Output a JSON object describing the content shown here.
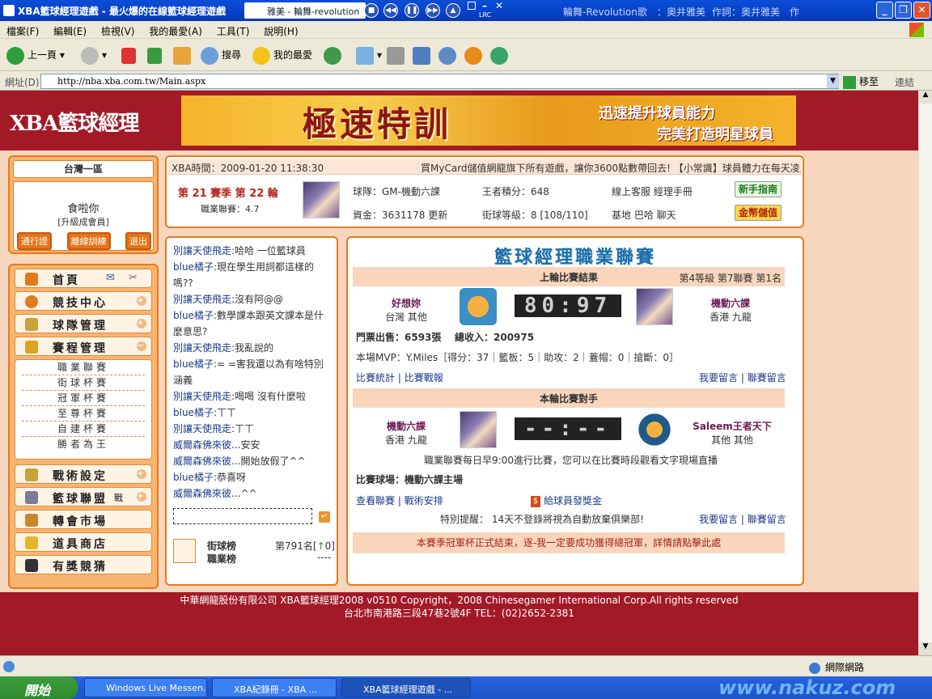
{
  "window": {
    "title": "XBA籃球經理遊戲 - 最火爆的在線籃球經理遊戲",
    "player_track": "雅美 - 輪舞-revolution",
    "lrc_label": "LRC",
    "song_title": "輪舞-Revolution",
    "song_info_song": "歌",
    "song_info_singer": "：奧井雅美",
    "song_info_lyricist": "作詞：奧井雅美",
    "song_info_more": "作"
  },
  "menu": [
    "檔案(F)",
    "編輯(E)",
    "檢視(V)",
    "我的最愛(A)",
    "工具(T)",
    "說明(H)"
  ],
  "toolbar": {
    "back": "上一頁",
    "search": "搜尋",
    "favorites": "我的最愛"
  },
  "address": {
    "label": "網址(D)",
    "url": "http://nba.xba.com.tw/Main.aspx",
    "go": "移至",
    "links": "連結"
  },
  "header": {
    "logo": "XBA籃球經理",
    "banner_title": "極速特訓",
    "banner_line1": "迅速提升球員能力",
    "banner_line2": "完美打造明星球員"
  },
  "user": {
    "region": "台灣一區",
    "name": "食啦你",
    "level": "[升級成會員]",
    "buttons": [
      "通行證",
      "離線訓練",
      "退出"
    ]
  },
  "nav": {
    "items": [
      "首頁",
      "競技中心",
      "球隊管理",
      "賽程管理",
      "戰術設定",
      "籃球聯盟",
      "轉會市場",
      "道具商店",
      "有獎競猜"
    ],
    "alliance_suffix": "戰",
    "sub": [
      "職業聯賽",
      "街球杯賽",
      "冠軍杯賽",
      "至尊杯賽",
      "自建杯賽",
      "勝者為王"
    ]
  },
  "info": {
    "time": "XBA時間：2009-01-20 11:38:30",
    "marquee": "買MyCard儲值網龍旗下所有遊戲，讓你3600點數帶回去! 【小常識】球員體力在每天凌晨",
    "season": "第 21 賽季  第 22 輪",
    "career_score": "職業聯賽：4.7",
    "team": "球隊：GM-機動六課",
    "points": "王者積分：648",
    "service": "線上客服  經理手冊",
    "newbie_btn": "新手指南",
    "funds": "資金：3631178  更新",
    "street_level": "街球等級：8 [108/110]",
    "base": "基地  巴哈  聊天",
    "gold_btn": "金幣儲值"
  },
  "chat": [
    {
      "name": "別讓天使飛走",
      "msg": ":哈哈  一位籃球員"
    },
    {
      "name": "blue橘子",
      "msg": ":現在學生用詞都這樣的嗎??"
    },
    {
      "name": "別讓天使飛走",
      "msg": ":沒有阿@@"
    },
    {
      "name": "blue橘子",
      "msg": ":數學課本跟英文課本是什麼意思?"
    },
    {
      "name": "別讓天使飛走",
      "msg": ":我亂說的"
    },
    {
      "name": "blue橘子",
      "msg": ":= =害我還以為有啥特別涵義"
    },
    {
      "name": "別讓天使飛走",
      "msg": ":喝喝  沒有什麼啦"
    },
    {
      "name": "blue橘子",
      "msg": ":ㄒㄒ"
    },
    {
      "name": "別讓天使飛走",
      "msg": ":ㄒㄒ"
    },
    {
      "name": "威爾森佛來彼",
      "msg": "...安安"
    },
    {
      "name": "威爾森佛來彼",
      "msg": "...開始放假了^^"
    },
    {
      "name": "blue橘子",
      "msg": ":恭喜呀"
    },
    {
      "name": "威爾森佛來彼",
      "msg": "...^^"
    }
  ],
  "ranking": {
    "street_label": "街球榜",
    "street_rank": "第791名[",
    "street_arrow": "↑",
    "street_change": "0]",
    "career_label": "職業榜",
    "career_value": "----"
  },
  "league": {
    "title": "籃球經理職業聯賽",
    "last_result_title": "上輪比賽結果",
    "level_info": "第4等級  第7聯賽  第1名",
    "home_team": "好想妳",
    "home_loc": "台灣  其他",
    "score": "80:97",
    "away_team": "機動六課",
    "away_loc": "香港  九龍",
    "tickets": "門票出售：6593張",
    "income": "總收入：200975",
    "mvp": "本場MVP：Y.Miles［得分：37｜籃板：5｜助攻：2｜蓋帽：0｜搶斷：0］",
    "stats_link": "比賽統計",
    "report_link": "比賽戰報",
    "leave_msg": "我要留言",
    "league_msg": "聯賽留言",
    "opponent_title": "本輪比賽對手",
    "next_home": "機動六課",
    "next_home_loc": "香港  九龍",
    "next_score": "--:--",
    "next_away": "Saleem王者天下",
    "next_away_loc": "其他  其他",
    "schedule_note": "職業聯賽每日早9:00進行比賽，您可以在比賽時段觀看文字現場直播",
    "venue": "比賽球場：機動六課主場",
    "view_league": "查看聯賽",
    "tactic": "戰術安排",
    "bonus": "給球員發獎金",
    "warning": "特別提醒：  14天不登錄將視為自動放棄俱樂部!",
    "notice": "本賽季冠軍杯正式結束，逐-我一定要成功獲得總冠軍，詳情請點擊此處"
  },
  "footer": {
    "line1": "中華網龍股份有限公司  XBA籃球經理2008 v0510     Copyright，2008 Chinesegamer International Corp.All rights reserved",
    "line2": "台北市南港路三段47巷2號4F TEL：(02)2652-2381"
  },
  "status": {
    "zone": "網際網路"
  },
  "taskbar": {
    "start": "開始",
    "tasks": [
      "Windows Live Messen...",
      "XBA紀錄冊 - XBA ...",
      "XBA籃球經理遊戲 - ..."
    ],
    "watermark": "www.nakuz.com"
  }
}
